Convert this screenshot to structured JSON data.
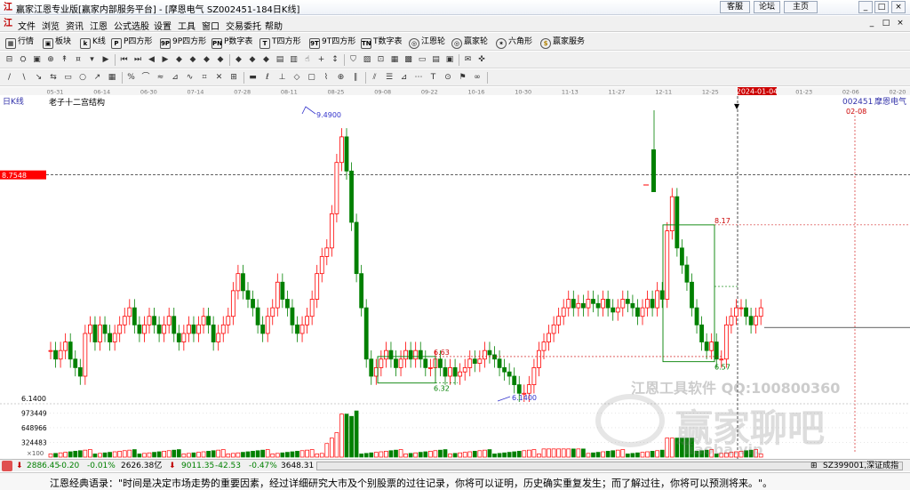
{
  "window": {
    "title": "赢家江恩专业版[赢家内部服务平台] - [摩恩电气  SZ002451-184日K线]",
    "logo_text": "江",
    "service_buttons": [
      "客服",
      "论坛",
      "主页"
    ],
    "controls": [
      "_",
      "□",
      "×"
    ]
  },
  "menu": {
    "logo_text": "江",
    "items": [
      "文件",
      "浏览",
      "资讯",
      "江恩",
      "公式选股",
      "设置",
      "工具",
      "窗口",
      "交易委托",
      "帮助"
    ],
    "win_controls": [
      "_",
      "□",
      "×"
    ]
  },
  "toolbar1": {
    "buttons": [
      {
        "icon": "grid",
        "label": "行情"
      },
      {
        "icon": "blocks",
        "label": "板块"
      },
      {
        "icon": "k",
        "label": "K线"
      },
      {
        "icon": "P",
        "label": "P四方形"
      },
      {
        "icon": "9P",
        "label": "9P四方形"
      },
      {
        "icon": "PN",
        "label": "P数字表"
      },
      {
        "icon": "T",
        "label": "T四方形"
      },
      {
        "icon": "9T",
        "label": "9T四方形"
      },
      {
        "icon": "TN",
        "label": "T数字表"
      },
      {
        "icon": "wheel",
        "label": "江恩轮"
      },
      {
        "icon": "wheel",
        "label": "赢家轮"
      },
      {
        "icon": "hex",
        "label": "六角形"
      },
      {
        "icon": "dollar",
        "label": "赢家服务"
      }
    ]
  },
  "toolbar2": {
    "icons": [
      "⊟",
      "⛭",
      "▣",
      "⊕",
      "↟",
      "¤",
      "▾",
      "▶",
      "⏮",
      "⏭",
      "◀",
      "▶",
      "◆",
      "◆",
      "◆",
      "◆",
      "◆",
      "◆",
      "◆",
      "▤",
      "▥",
      "☝",
      "+",
      "↕",
      "⛉",
      "▨",
      "⊡",
      "▦",
      "▩",
      "▭",
      "▤",
      "▣",
      "✉",
      "✜"
    ]
  },
  "toolbar3": {
    "icons": [
      "/",
      "\\",
      "↘",
      "⇆",
      "▭",
      "○",
      "↗",
      "▦",
      "%",
      "⌒",
      "≈",
      "⊿",
      "∿",
      "⌗",
      "✕",
      "⊞",
      "▬",
      "ℓ",
      "⊥",
      "◇",
      "▢",
      "⌇",
      "⊕",
      "∥",
      "⫽",
      "☰",
      "⊿",
      "⋯",
      "T",
      "⊙",
      "⚑",
      "∞"
    ]
  },
  "chart": {
    "period_label": "日K线",
    "structure_label": "老子十二宫结构",
    "stock_code": "002451",
    "stock_name": "摩恩电气",
    "right_date": "02-08",
    "cursor_price": "8.7548",
    "date_ticks": [
      "05-31",
      "06-14",
      "06-30",
      "07-14",
      "07-28",
      "08-11",
      "08-25",
      "09-08",
      "09-22",
      "10-16",
      "10-30",
      "11-13",
      "11-27",
      "12-11",
      "12-25",
      "2024-01-04",
      "01-23",
      "02-06",
      "02-20"
    ],
    "highlight_date": "2024-01-04",
    "price_labels": [
      "9.4900",
      "6.1400",
      "8.17",
      "6.63",
      "6.32",
      "6.57"
    ],
    "axis_low_label": "6.1400",
    "volume_labels": [
      "973449",
      "648966",
      "324483"
    ],
    "volume_unit": "×100",
    "watermark": {
      "line1": "江恩工具软件  QQ:100800360",
      "line2": "赢家聊吧",
      "line3": "liaoba.vip"
    }
  },
  "chart_data": {
    "type": "candlestick",
    "series_name": "摩恩电气 SZ002451 日K线",
    "high": 9.49,
    "low": 6.14,
    "annotations": [
      {
        "label": "9.4900",
        "type": "high"
      },
      {
        "label": "6.1400",
        "type": "low"
      },
      {
        "label": "8.17",
        "type": "box-top"
      },
      {
        "label": "6.57",
        "type": "box-bottom"
      },
      {
        "label": "6.63",
        "type": "box-top"
      },
      {
        "label": "6.32",
        "type": "box-bottom"
      }
    ],
    "volume_axis": [
      324483,
      648966,
      973449
    ]
  },
  "statusbar": {
    "index1": "2886.45",
    "index1_change": "-0.20",
    "index1_pct": "-0.01%",
    "index1_amount": "2626.38亿",
    "index2": "9011.35",
    "index2_change": "-42.53",
    "index2_pct": "-0.47%",
    "index2_amount": "3648.31",
    "right": "SZ399001,深证成指"
  },
  "quote": {
    "text": "江恩经典语录：\"时间是决定市场走势的重要因素，经过详细研究大市及个别股票的过往记录，你将可以证明，历史确实重复发生；而了解过往，你将可以预测将来。\"。"
  },
  "colors": {
    "up": "#ff0000",
    "down": "#008000",
    "highlight_date_bg": "#cc0000",
    "price_tag_bg": "#ff0000",
    "annotation_blue": "#3333cc"
  }
}
